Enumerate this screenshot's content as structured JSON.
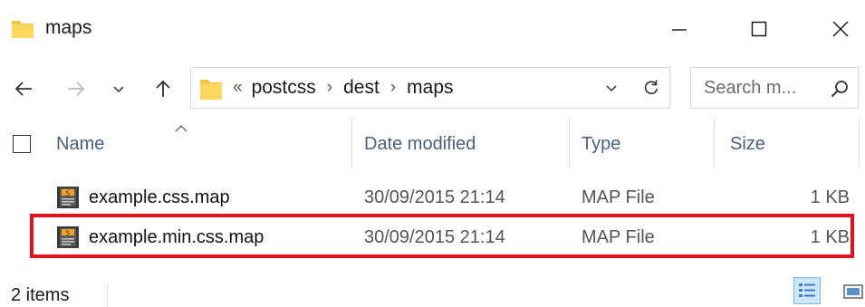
{
  "window": {
    "title": "maps",
    "controls": [
      "minimize",
      "maximize",
      "close"
    ],
    "icon": "folder-icon"
  },
  "navigation": {
    "back_icon": "back-arrow-icon",
    "forward_icon": "forward-arrow-icon",
    "recent_icon": "chevron-down-icon",
    "up_icon": "up-arrow-icon"
  },
  "address": {
    "overflow_glyph": "«",
    "breadcrumbs": [
      {
        "label": "postcss"
      },
      {
        "label": "dest"
      },
      {
        "label": "maps"
      }
    ],
    "separator": "›"
  },
  "search": {
    "placeholder": "Search m..."
  },
  "columns": {
    "name": "Name",
    "date": "Date modified",
    "type": "Type",
    "size": "Size"
  },
  "files": [
    {
      "name": "example.css.map",
      "date": "30/09/2015 21:14",
      "type": "MAP File",
      "size": "1 KB",
      "icon": "map-file-icon",
      "highlighted": false
    },
    {
      "name": "example.min.css.map",
      "date": "30/09/2015 21:14",
      "type": "MAP File",
      "size": "1 KB",
      "icon": "map-file-icon",
      "highlighted": true
    }
  ],
  "status": {
    "item_count": "2 items",
    "views": [
      "details",
      "large-icons"
    ]
  },
  "colors": {
    "folder": "#f5c542",
    "header_text": "#4c607a",
    "highlight_border": "#e8101a",
    "selected_view": "#cde6fb"
  }
}
